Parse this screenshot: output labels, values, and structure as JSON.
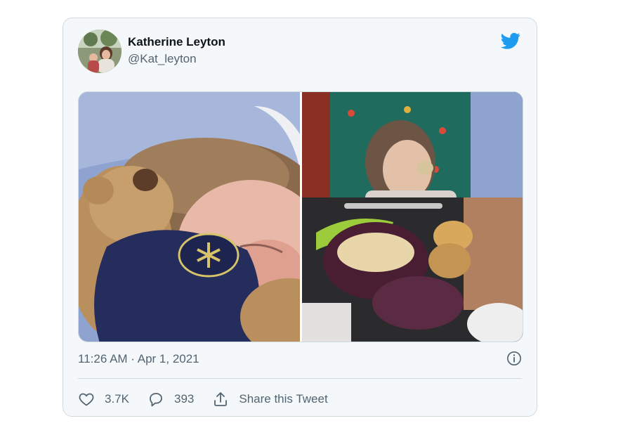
{
  "tweet": {
    "author_name": "Katherine Leyton",
    "author_handle": "@Kat_leyton",
    "timestamp": "11:26 AM · Apr 1, 2021",
    "likes": "3.7K",
    "replies": "393",
    "share_label": "Share this Tweet"
  },
  "colors": {
    "twitter_blue": "#1d9bf0",
    "secondary_text": "#536471",
    "card_background": "#f5f8fa"
  },
  "icons": [
    "twitter-bird-icon",
    "info-icon",
    "heart-icon",
    "reply-icon",
    "share-icon"
  ]
}
